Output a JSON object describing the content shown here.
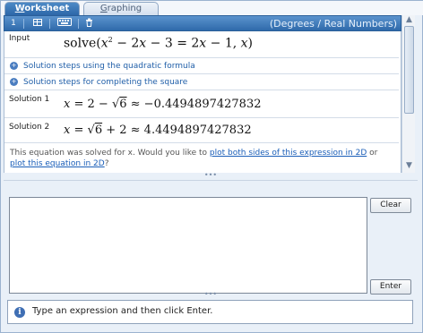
{
  "tabs": {
    "worksheet": {
      "u": "W",
      "rest": "orksheet"
    },
    "graphing": {
      "u": "G",
      "rest": "raphing"
    }
  },
  "toolbar": {
    "item1": "1",
    "mode": "(Degrees / Real Numbers)"
  },
  "worksheet": {
    "input_label": "Input",
    "input_expr": {
      "fn": "solve(",
      "x1": "x",
      "exp": "2",
      "mid": " − 2",
      "x2": "x",
      "mid2": " − 3 = 2",
      "x3": "x",
      "mid3": " − 1, ",
      "x4": "x",
      "end": ")"
    },
    "steps": [
      "Solution steps using the quadratic formula",
      "Solution steps for completing the square"
    ],
    "solutions": [
      {
        "label": "Solution 1",
        "var": "x",
        "eq": " = 2 − ",
        "radical": "√",
        "radicand": "6",
        "approx": " ≈ −0.4494897427832"
      },
      {
        "label": "Solution 2",
        "var": "x",
        "eq": " = ",
        "radical": "√",
        "radicand": "6",
        "tail": " + 2 ≈ 4.4494897427832"
      }
    ],
    "message": {
      "prefix": "This equation was solved for x. Would you like to ",
      "link1": "plot both sides of this expression in 2D",
      "middle": " or ",
      "link2": "plot this equation in 2D",
      "suffix": "?"
    }
  },
  "splitter_glyph": "•••",
  "input": {
    "value": "",
    "clear_label": "Clear",
    "enter_label": "Enter"
  },
  "status": {
    "icon": "i",
    "text": "Type an expression and then click Enter."
  },
  "colors": {
    "tab_active": "#2d67a9",
    "toolbar": "#3f78b8",
    "link": "#1a5eb8"
  }
}
